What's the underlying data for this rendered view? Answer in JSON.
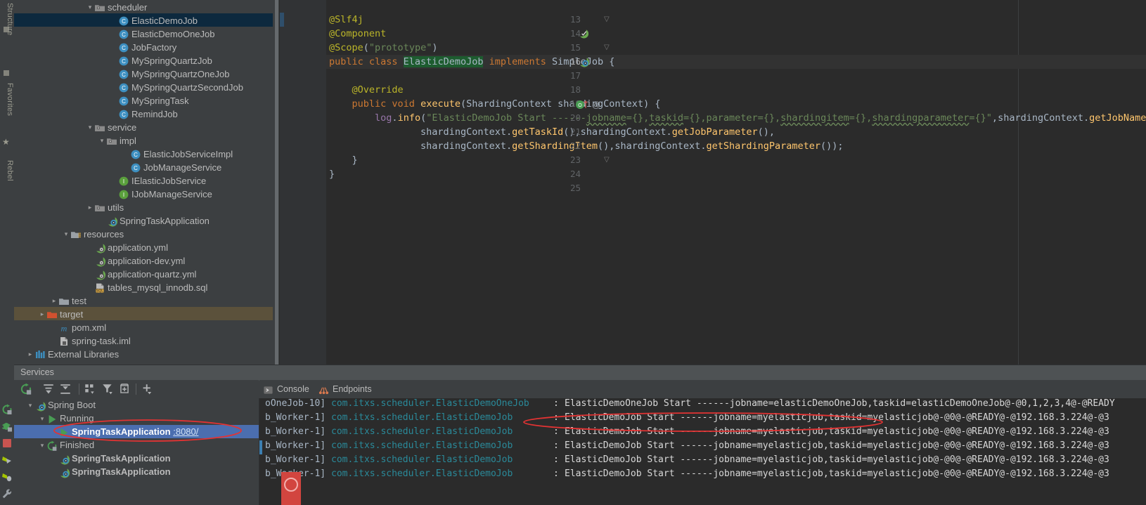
{
  "left_tool_strip": {
    "tabs": [
      "Structure",
      "Favorites",
      "Rebel"
    ]
  },
  "project_tree": {
    "items": [
      {
        "indent": 6,
        "arrow": "v",
        "icon": "folder-package-icon",
        "label": "scheduler",
        "state": "normal"
      },
      {
        "indent": 8,
        "arrow": "",
        "icon": "class-icon",
        "label": "ElasticDemoJob",
        "state": "selected"
      },
      {
        "indent": 8,
        "arrow": "",
        "icon": "class-icon",
        "label": "ElasticDemoOneJob",
        "state": "normal"
      },
      {
        "indent": 8,
        "arrow": "",
        "icon": "class-icon",
        "label": "JobFactory",
        "state": "normal"
      },
      {
        "indent": 8,
        "arrow": "",
        "icon": "class-icon",
        "label": "MySpringQuartzJob",
        "state": "normal"
      },
      {
        "indent": 8,
        "arrow": "",
        "icon": "class-icon",
        "label": "MySpringQuartzOneJob",
        "state": "normal"
      },
      {
        "indent": 8,
        "arrow": "",
        "icon": "class-icon",
        "label": "MySpringQuartzSecondJob",
        "state": "normal"
      },
      {
        "indent": 8,
        "arrow": "",
        "icon": "class-icon",
        "label": "MySpringTask",
        "state": "normal"
      },
      {
        "indent": 8,
        "arrow": "",
        "icon": "class-icon",
        "label": "RemindJob",
        "state": "normal"
      },
      {
        "indent": 6,
        "arrow": "v",
        "icon": "folder-package-icon",
        "label": "service",
        "state": "normal"
      },
      {
        "indent": 7,
        "arrow": "v",
        "icon": "folder-package-icon",
        "label": "impl",
        "state": "normal"
      },
      {
        "indent": 9,
        "arrow": "",
        "icon": "class-icon",
        "label": "ElasticJobServiceImpl",
        "state": "normal"
      },
      {
        "indent": 9,
        "arrow": "",
        "icon": "class-icon",
        "label": "JobManageService",
        "state": "normal"
      },
      {
        "indent": 8,
        "arrow": "",
        "icon": "interface-icon",
        "label": "IElasticJobService",
        "state": "normal"
      },
      {
        "indent": 8,
        "arrow": "",
        "icon": "interface-icon",
        "label": "IJobManageService",
        "state": "normal"
      },
      {
        "indent": 6,
        "arrow": ">",
        "icon": "folder-package-icon",
        "label": "utils",
        "state": "normal"
      },
      {
        "indent": 7,
        "arrow": "",
        "icon": "spring-boot-icon",
        "label": "SpringTaskApplication",
        "state": "normal"
      },
      {
        "indent": 4,
        "arrow": "v",
        "icon": "resources-folder-icon",
        "label": "resources",
        "state": "normal"
      },
      {
        "indent": 6,
        "arrow": "",
        "icon": "yaml-spring-icon",
        "label": "application.yml",
        "state": "normal"
      },
      {
        "indent": 6,
        "arrow": "",
        "icon": "yaml-spring-icon",
        "label": "application-dev.yml",
        "state": "normal"
      },
      {
        "indent": 6,
        "arrow": "",
        "icon": "yaml-spring-icon",
        "label": "application-quartz.yml",
        "state": "normal"
      },
      {
        "indent": 6,
        "arrow": "",
        "icon": "sql-file-icon",
        "label": "tables_mysql_innodb.sql",
        "state": "normal"
      },
      {
        "indent": 3,
        "arrow": ">",
        "icon": "folder-icon",
        "label": "test",
        "state": "normal"
      },
      {
        "indent": 2,
        "arrow": ">",
        "icon": "folder-orange-icon",
        "label": "target",
        "state": "target-selected"
      },
      {
        "indent": 3,
        "arrow": "",
        "icon": "maven-icon",
        "label": "pom.xml",
        "state": "normal"
      },
      {
        "indent": 3,
        "arrow": "",
        "icon": "iml-icon",
        "label": "spring-task.iml",
        "state": "normal"
      },
      {
        "indent": 1,
        "arrow": ">",
        "icon": "library-icon",
        "label": "External Libraries",
        "state": "normal"
      }
    ]
  },
  "editor": {
    "lines": [
      {
        "num": "",
        "text": "",
        "gutter": ""
      },
      {
        "num": "13",
        "gutter": "fold-collapse",
        "html": "<span class=\"a\">@Slf4j</span>"
      },
      {
        "num": "14",
        "gutter": "spring-bean-icon",
        "html": "<span class=\"a\">@Component</span>"
      },
      {
        "num": "15",
        "gutter": "fold-collapse",
        "html": "<span class=\"a\">@Scope</span><span class=\"t\">(</span><span class=\"s\">\"prototype\"</span><span class=\"t\">)</span>"
      },
      {
        "num": "16",
        "gutter": "spring-class-icon",
        "current": true,
        "html": "<span class=\"k\">public class </span><span class=\"hl\">ElasticDemoJob</span><span class=\"k\"> implements </span><span class=\"t\">SimpleJob {</span>"
      },
      {
        "num": "17",
        "gutter": "",
        "html": ""
      },
      {
        "num": "18",
        "gutter": "",
        "html": "    <span class=\"a\">@Override</span>"
      },
      {
        "num": "19",
        "gutter": "override-icon",
        "html": "    <span class=\"k\">public void </span><span class=\"m\">execute</span><span class=\"t\">(</span><span class=\"t\">ShardingContext shardingContext</span><span class=\"t\">) {</span>"
      },
      {
        "num": "20",
        "gutter": "",
        "html": "        <span class=\"f\">log</span><span class=\"t\">.</span><span class=\"m\">info</span><span class=\"t\">(</span><span class=\"s\">\"ElasticDemoJob Start ------</span><span class=\"s sq\">jobname</span><span class=\"s\">={},</span><span class=\"s sq\">taskid</span><span class=\"s\">={},parameter={},</span><span class=\"s sq\">shardingitem</span><span class=\"s\">={},</span><span class=\"s sq\">shardingparameter</span><span class=\"s\">={}\"</span><span class=\"t\">,</span><span class=\"t\">shardingContext.</span><span class=\"m\">getJobName</span>"
      },
      {
        "num": "21",
        "gutter": "",
        "html": "                <span class=\"t\">shardingContext.</span><span class=\"m\">getTaskId</span><span class=\"t\">(),shardingContext.</span><span class=\"m\">getJobParameter</span><span class=\"t\">(),</span>"
      },
      {
        "num": "22",
        "gutter": "",
        "html": "                <span class=\"t\">shardingContext.</span><span class=\"m\">getShardingItem</span><span class=\"t\">(),shardingContext.</span><span class=\"m\">getShardingParameter</span><span class=\"t\">());</span>"
      },
      {
        "num": "23",
        "gutter": "fold-collapse",
        "html": "    <span class=\"t\">}</span>"
      },
      {
        "num": "24",
        "gutter": "",
        "html": "<span class=\"t\">}</span>"
      },
      {
        "num": "25",
        "gutter": "",
        "html": ""
      }
    ]
  },
  "services": {
    "title": "Services",
    "toolbar": [
      {
        "name": "rerun-icon",
        "label": "Rerun"
      },
      {
        "name": "expand-all-icon",
        "label": "Expand All"
      },
      {
        "name": "collapse-all-icon",
        "label": "Collapse All"
      },
      {
        "name": "group-by-icon",
        "label": "Group By"
      },
      {
        "name": "filter-icon",
        "label": "Filter"
      },
      {
        "name": "show-in-new-window-icon",
        "label": "Open in New Window"
      },
      {
        "name": "add-service-icon",
        "label": "Add Service"
      }
    ],
    "run_controls": [
      {
        "name": "rerun-icon"
      },
      {
        "name": "debug-rerun-icon"
      },
      {
        "name": "stop-icon"
      },
      {
        "name": "run-with-jrebel-icon"
      },
      {
        "name": "debug-with-jrebel-icon"
      },
      {
        "name": "settings-wrench-icon"
      }
    ],
    "tree": [
      {
        "indent": 1,
        "arrow": "v",
        "icon": "spring-boot-icon",
        "label": "Spring Boot",
        "bold": false,
        "state": "normal",
        "suffix": ""
      },
      {
        "indent": 2,
        "arrow": "v",
        "icon": "run-green-icon",
        "label": "Running",
        "bold": false,
        "state": "normal",
        "suffix": ""
      },
      {
        "indent": 3,
        "arrow": "",
        "icon": "run-green-icon",
        "label": "SpringTaskApplication",
        "bold": true,
        "state": "selected",
        "suffix": ":8080/"
      },
      {
        "indent": 2,
        "arrow": "v",
        "icon": "rerun-icon",
        "label": "Finished",
        "bold": false,
        "state": "normal",
        "suffix": ""
      },
      {
        "indent": 3,
        "arrow": "",
        "icon": "spring-boot-icon",
        "label": "SpringTaskApplication",
        "bold": true,
        "state": "normal",
        "suffix": ""
      },
      {
        "indent": 3,
        "arrow": "",
        "icon": "spring-boot-icon",
        "label": "SpringTaskApplication",
        "bold": true,
        "state": "normal",
        "suffix": ""
      }
    ],
    "tabs": [
      {
        "label": "Console",
        "icon": "console-icon",
        "active": true
      },
      {
        "label": "Endpoints",
        "icon": "endpoints-icon",
        "active": false
      }
    ],
    "console_lines": [
      {
        "thread": "oOneJob-10]",
        "logger": "com.itxs.scheduler.ElasticDemoOneJob",
        "sep": ": ",
        "message": "ElasticDemoOneJob Start ------jobname=elasticDemoOneJob,taskid=elasticDemoOneJob@-@0,1,2,3,4@-@READY"
      },
      {
        "thread": "b_Worker-1]",
        "logger": "com.itxs.scheduler.ElasticDemoJob",
        "sep": ": ",
        "message": "ElasticDemoJob Start ------jobname=myelasticjob,taskid=myelasticjob@-@0@-@READY@-@192.168.3.224@-@3"
      },
      {
        "thread": "b_Worker-1]",
        "logger": "com.itxs.scheduler.ElasticDemoJob",
        "sep": ": ",
        "message": "ElasticDemoJob Start ------jobname=myelasticjob,taskid=myelasticjob@-@0@-@READY@-@192.168.3.224@-@3"
      },
      {
        "thread": "b_Worker-1]",
        "logger": "com.itxs.scheduler.ElasticDemoJob",
        "sep": ": ",
        "message": "ElasticDemoJob Start ------jobname=myelasticjob,taskid=myelasticjob@-@0@-@READY@-@192.168.3.224@-@3"
      },
      {
        "thread": "b_Worker-1]",
        "logger": "com.itxs.scheduler.ElasticDemoJob",
        "sep": ": ",
        "message": "ElasticDemoJob Start ------jobname=myelasticjob,taskid=myelasticjob@-@0@-@READY@-@192.168.3.224@-@3"
      },
      {
        "thread": "b_Worker-1]",
        "logger": "com.itxs.scheduler.ElasticDemoJob",
        "sep": ": ",
        "message": "ElasticDemoJob Start ------jobname=myelasticjob,taskid=myelasticjob@-@0@-@READY@-@192.168.3.224@-@3"
      }
    ]
  },
  "annotations": {
    "ellipse_service_row": "red ellipse around SpringTaskApplication :8080/",
    "ellipse_console_line": "red ellipse around ElasticDemoJob log line",
    "circle_bottom": "red filled circle marker"
  },
  "colors": {
    "accent_selection": "#4b6eaf",
    "tree_selection": "#0d293e",
    "target_selection": "#5b513b",
    "annotation_red": "#e33333",
    "editor_bg": "#2b2b2b",
    "panel_bg": "#3c3f41",
    "keyword": "#cc7832",
    "string": "#6a8759",
    "annotation_yellow": "#bbb529",
    "method": "#ffc66d",
    "field": "#9876aa",
    "logger_blue": "#287bde",
    "link_blue": "#5a9fd4"
  }
}
